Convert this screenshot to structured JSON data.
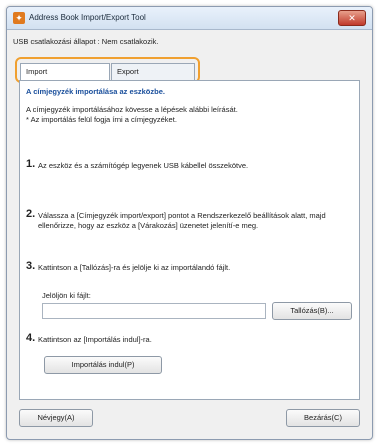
{
  "window": {
    "title": "Address Book Import/Export Tool",
    "close_label": "✕"
  },
  "status": "USB csatlakozási állapot : Nem csatlakozik.",
  "tabs": [
    {
      "label": "Import",
      "active": true
    },
    {
      "label": "Export",
      "active": false
    }
  ],
  "panel": {
    "title": "A címjegyzék importálása az eszközbe.",
    "intro_line1": "A címjegyzék importálásához kövesse a lépések alábbi leírását.",
    "intro_line2": "* Az importálás felül fogja írni a címjegyzéket.",
    "steps": [
      {
        "num": "1.",
        "text": "Az eszköz és a számítógép legyenek USB kábellel összekötve."
      },
      {
        "num": "2.",
        "text": "Válassza a [Címjegyzék import/export] pontot a Rendszerkezelő beállítások alatt, majd ellenőrizze, hogy az eszköz a [Várakozás] üzenetet jelenítí-e meg."
      },
      {
        "num": "3.",
        "text": "Kattintson a [Tallózás]-ra és jelölje ki az importálandó fájlt."
      },
      {
        "num": "4.",
        "text": "Kattintson az [Importálás indul]-ra."
      }
    ],
    "file_label": "Jelöljön ki fájlt:",
    "file_value": "",
    "browse_label": "Tallózás(B)...",
    "start_label": "Importálás indul(P)"
  },
  "footer": {
    "contacts_label": "Névjegy(A)",
    "close_label": "Bezárás(C)"
  },
  "colors": {
    "accent": "#f0a030",
    "heading": "#1a4f9c"
  }
}
